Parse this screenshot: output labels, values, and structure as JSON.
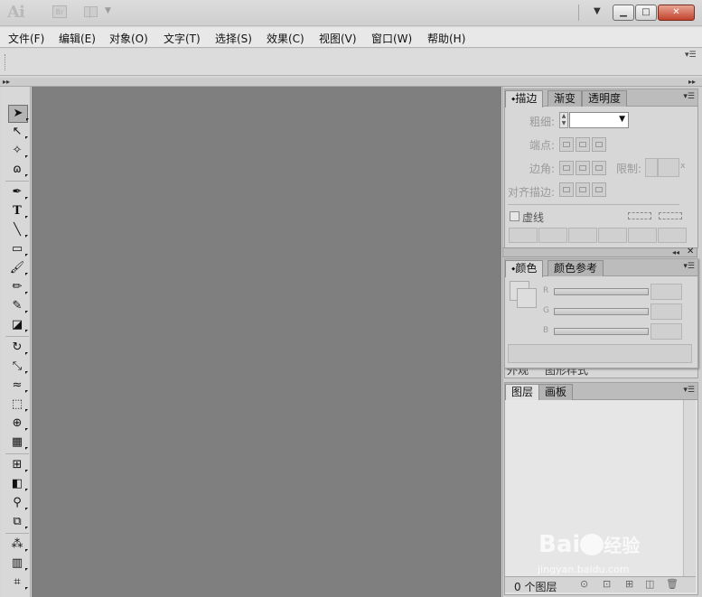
{
  "app": {
    "logo": "Ai",
    "bridge_label": "Br",
    "window_buttons": {
      "minimize": "▁",
      "maximize": "□",
      "close": "✕"
    }
  },
  "menu": [
    "文件(F)",
    "编辑(E)",
    "对象(O)",
    "文字(T)",
    "选择(S)",
    "效果(C)",
    "视图(V)",
    "窗口(W)",
    "帮助(H)"
  ],
  "tools": [
    "selection-tool-icon",
    "direct-selection-tool-icon",
    "magic-wand-tool-icon",
    "lasso-tool-icon",
    "pen-tool-icon",
    "type-tool-icon",
    "line-segment-tool-icon",
    "rectangle-tool-icon",
    "paintbrush-tool-icon",
    "pencil-tool-icon",
    "blob-brush-tool-icon",
    "eraser-tool-icon",
    "rotate-tool-icon",
    "scale-tool-icon",
    "warp-tool-icon",
    "free-transform-tool-icon",
    "shape-builder-tool-icon",
    "perspective-grid-tool-icon",
    "mesh-tool-icon",
    "gradient-tool-icon",
    "eyedropper-tool-icon",
    "blend-tool-icon",
    "symbol-sprayer-tool-icon",
    "column-graph-tool-icon",
    "artboard-tool-icon"
  ],
  "stroke_panel": {
    "tabs": [
      "描边",
      "渐变",
      "透明度"
    ],
    "weight_label": "粗细:",
    "cap_label": "端点:",
    "corner_label": "边角:",
    "limit_label": "限制:",
    "limit_unit": "x",
    "align_label": "对齐描边:",
    "dashed_label": "虚线"
  },
  "color_panel": {
    "tabs": [
      "颜色",
      "颜色参考"
    ],
    "channels": [
      "R",
      "G",
      "B"
    ]
  },
  "appearance_panel": {
    "tabs": [
      "外观",
      "图形样式"
    ]
  },
  "layers_panel": {
    "tabs": [
      "图层",
      "画板"
    ],
    "status": "0 个图层"
  },
  "watermark": {
    "line1": "Bai",
    "line2": "经验",
    "url": "jingyan.baidu.com"
  }
}
